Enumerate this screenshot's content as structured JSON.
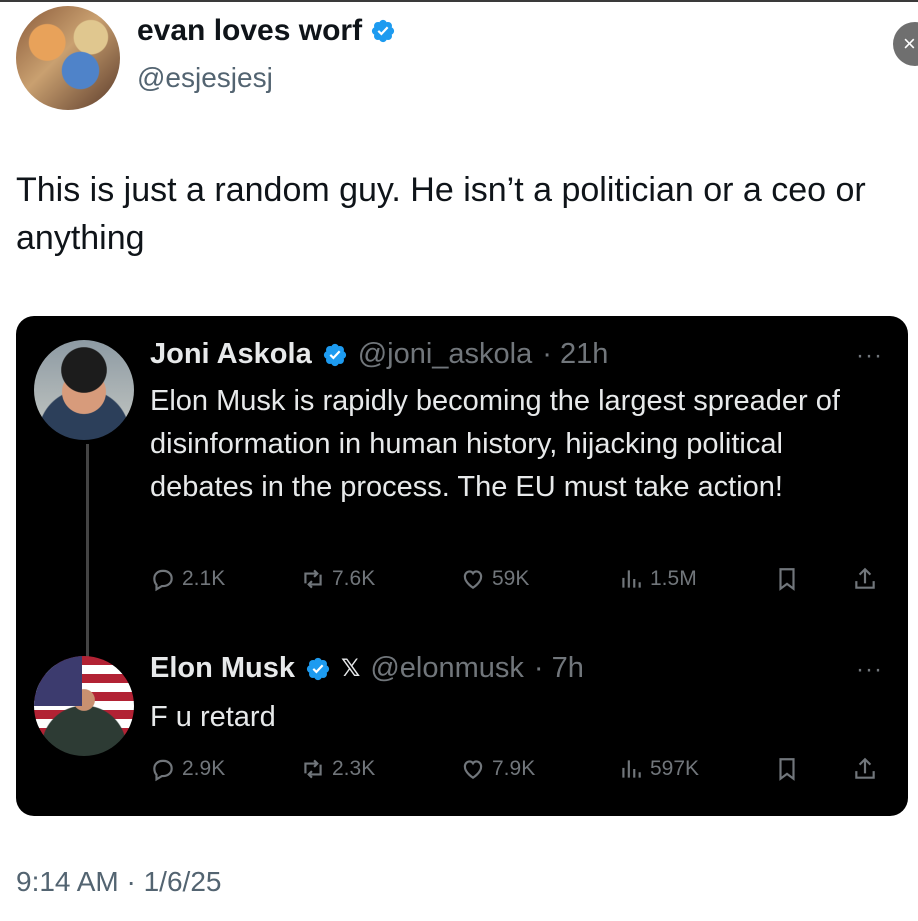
{
  "close_icon": "×",
  "author": {
    "display_name": "evan loves worf",
    "handle": "@esjesjesj",
    "verified": true
  },
  "tweet": {
    "text": "This is just a random guy. He isn’t a politician or a ceo or anything",
    "timestamp": "9:14 AM · 1/6/25"
  },
  "quoted_thread": [
    {
      "name": "Joni Askola",
      "handle": "@joni_askola",
      "time": "· 21h",
      "verified": true,
      "text": "Elon Musk is rapidly becoming the largest spreader of disinformation in human history, hijacking political debates in the process. The EU must take action!",
      "more": "···",
      "stats": {
        "replies": "2.1K",
        "reposts": "7.6K",
        "likes": "59K",
        "views": "1.5M"
      }
    },
    {
      "name": "Elon Musk",
      "handle": "@elonmusk",
      "time": "· 7h",
      "verified": true,
      "affiliation_badge": "𝕏",
      "text": "F u retard",
      "more": "···",
      "stats": {
        "replies": "2.9K",
        "reposts": "2.3K",
        "likes": "7.9K",
        "views": "597K"
      }
    }
  ],
  "colors": {
    "verified_blue": "#1d9bf0",
    "card_bg": "#000000",
    "muted_text": "#71767b"
  }
}
